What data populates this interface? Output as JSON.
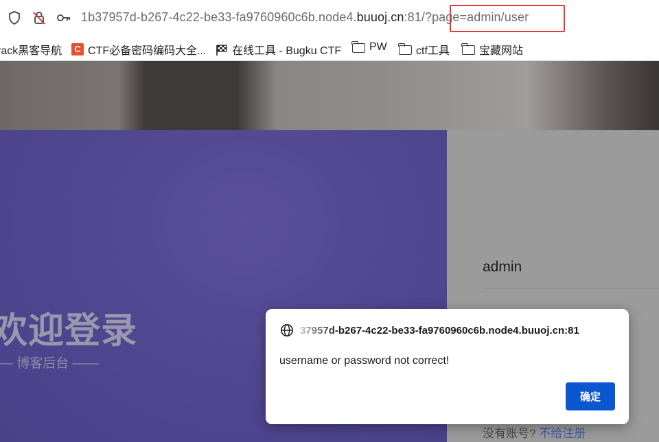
{
  "browser": {
    "url_prefix": "1b37957d-b267-4c22-be33-fa9760960c6b.node4.",
    "url_host": "buuoj.cn",
    "url_port_path": ":81/",
    "url_query": "?page=admin/user",
    "highlight_color": "#e53935"
  },
  "bookmarks": [
    {
      "label": "rack黑客导航",
      "icon": "none"
    },
    {
      "label": "CTF必备密码编码大全...",
      "icon": "ctf-c-icon",
      "icon_text": "C"
    },
    {
      "label": "在线工具 - Bugku CTF",
      "icon": "flag-icon"
    },
    {
      "label": "PW",
      "icon": "folder-icon"
    },
    {
      "label": "ctf工具",
      "icon": "folder-icon"
    },
    {
      "label": "宝藏网站",
      "icon": "folder-icon"
    }
  ],
  "page": {
    "welcome_title": "欢迎登录",
    "welcome_subtitle": "— 博客后台 ——",
    "username_value": "admin",
    "register_prompt": "没有账号?",
    "register_link": "不给注册",
    "panel_color": "#4f4690"
  },
  "dialog": {
    "origin": "37957d-b267-4c22-be33-fa9760960c6b.node4.buuoj.cn:81",
    "message": "username or password not correct!",
    "ok_label": "确定",
    "ok_color": "#0b57d0"
  }
}
